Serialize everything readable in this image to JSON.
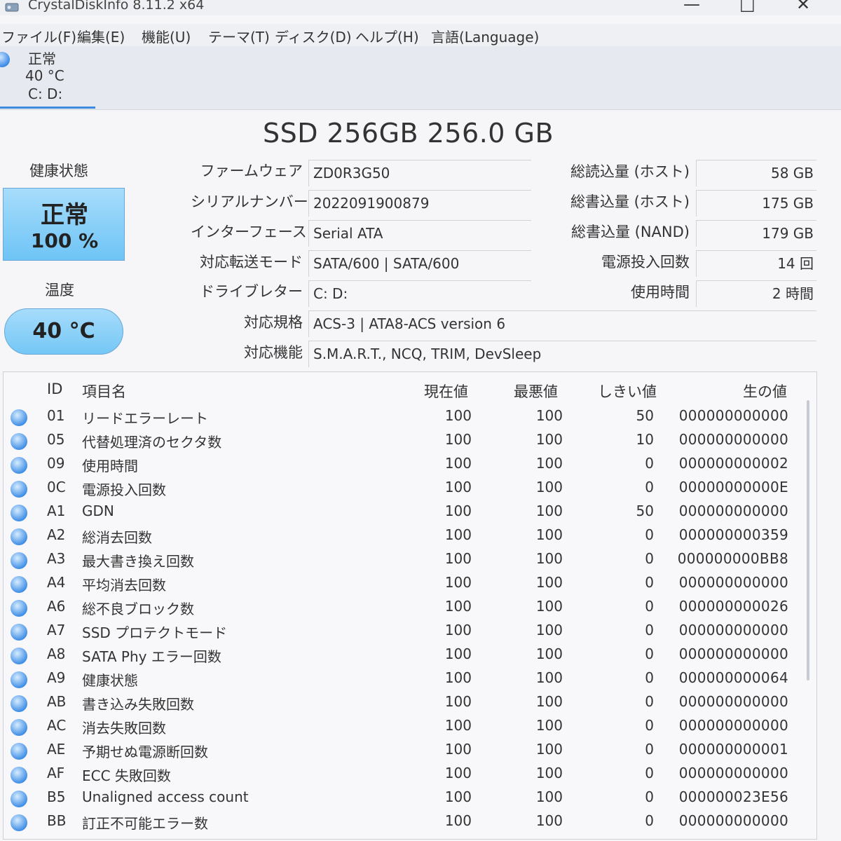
{
  "window": {
    "title": "CrystalDiskInfo 8.11.2 x64",
    "minimize": "—",
    "maximize": "□",
    "close": "✕"
  },
  "menu": [
    "ファイル(F)",
    "編集(E)",
    "機能(U)",
    "テーマ(T)",
    "ディスク(D)",
    "ヘルプ(H)",
    "言語(Language)"
  ],
  "disk_tab": {
    "status": "正常",
    "temp": "40 °C",
    "letters": "C: D:"
  },
  "model": "SSD 256GB 256.0 GB",
  "health": {
    "label": "健康状態",
    "status": "正常",
    "percent": "100 %"
  },
  "temperature": {
    "label": "温度",
    "value": "40 °C"
  },
  "info": [
    {
      "label": "ファームウェア",
      "value": "ZD0R3G50"
    },
    {
      "label": "シリアルナンバー",
      "value": "2022091900879"
    },
    {
      "label": "インターフェース",
      "value": "Serial ATA"
    },
    {
      "label": "対応転送モード",
      "value": "SATA/600 | SATA/600"
    },
    {
      "label": "ドライブレター",
      "value": "C: D:"
    },
    {
      "label": "対応規格",
      "value": "ACS-3 | ATA8-ACS version 6"
    },
    {
      "label": "対応機能",
      "value": "S.M.A.R.T., NCQ, TRIM, DevSleep"
    }
  ],
  "stats": [
    {
      "label": "総読込量 (ホスト)",
      "value": "58 GB"
    },
    {
      "label": "総書込量 (ホスト)",
      "value": "175 GB"
    },
    {
      "label": "総書込量 (NAND)",
      "value": "179 GB"
    },
    {
      "label": "電源投入回数",
      "value": "14 回"
    },
    {
      "label": "使用時間",
      "value": "2 時間"
    }
  ],
  "smart": {
    "headers": {
      "id": "ID",
      "name": "項目名",
      "current": "現在値",
      "worst": "最悪値",
      "threshold": "しきい値",
      "raw": "生の値"
    },
    "rows": [
      {
        "id": "01",
        "name": "リードエラーレート",
        "current": "100",
        "worst": "100",
        "threshold": "50",
        "raw": "000000000000"
      },
      {
        "id": "05",
        "name": "代替処理済のセクタ数",
        "current": "100",
        "worst": "100",
        "threshold": "10",
        "raw": "000000000000"
      },
      {
        "id": "09",
        "name": "使用時間",
        "current": "100",
        "worst": "100",
        "threshold": "0",
        "raw": "000000000002"
      },
      {
        "id": "0C",
        "name": "電源投入回数",
        "current": "100",
        "worst": "100",
        "threshold": "0",
        "raw": "00000000000E"
      },
      {
        "id": "A1",
        "name": "GDN",
        "current": "100",
        "worst": "100",
        "threshold": "50",
        "raw": "000000000000"
      },
      {
        "id": "A2",
        "name": "総消去回数",
        "current": "100",
        "worst": "100",
        "threshold": "0",
        "raw": "000000000359"
      },
      {
        "id": "A3",
        "name": "最大書き換え回数",
        "current": "100",
        "worst": "100",
        "threshold": "0",
        "raw": "000000000BB8"
      },
      {
        "id": "A4",
        "name": "平均消去回数",
        "current": "100",
        "worst": "100",
        "threshold": "0",
        "raw": "000000000000"
      },
      {
        "id": "A6",
        "name": "総不良ブロック数",
        "current": "100",
        "worst": "100",
        "threshold": "0",
        "raw": "000000000026"
      },
      {
        "id": "A7",
        "name": "SSD プロテクトモード",
        "current": "100",
        "worst": "100",
        "threshold": "0",
        "raw": "000000000000"
      },
      {
        "id": "A8",
        "name": "SATA Phy エラー回数",
        "current": "100",
        "worst": "100",
        "threshold": "0",
        "raw": "000000000000"
      },
      {
        "id": "A9",
        "name": "健康状態",
        "current": "100",
        "worst": "100",
        "threshold": "0",
        "raw": "000000000064"
      },
      {
        "id": "AB",
        "name": "書き込み失敗回数",
        "current": "100",
        "worst": "100",
        "threshold": "0",
        "raw": "000000000000"
      },
      {
        "id": "AC",
        "name": "消去失敗回数",
        "current": "100",
        "worst": "100",
        "threshold": "0",
        "raw": "000000000000"
      },
      {
        "id": "AE",
        "name": "予期せぬ電源断回数",
        "current": "100",
        "worst": "100",
        "threshold": "0",
        "raw": "000000000001"
      },
      {
        "id": "AF",
        "name": "ECC 失敗回数",
        "current": "100",
        "worst": "100",
        "threshold": "0",
        "raw": "000000000000"
      },
      {
        "id": "B5",
        "name": "Unaligned access count",
        "current": "100",
        "worst": "100",
        "threshold": "0",
        "raw": "000000023E56"
      },
      {
        "id": "BB",
        "name": "訂正不可能エラー数",
        "current": "100",
        "worst": "100",
        "threshold": "0",
        "raw": "000000000000"
      }
    ]
  }
}
